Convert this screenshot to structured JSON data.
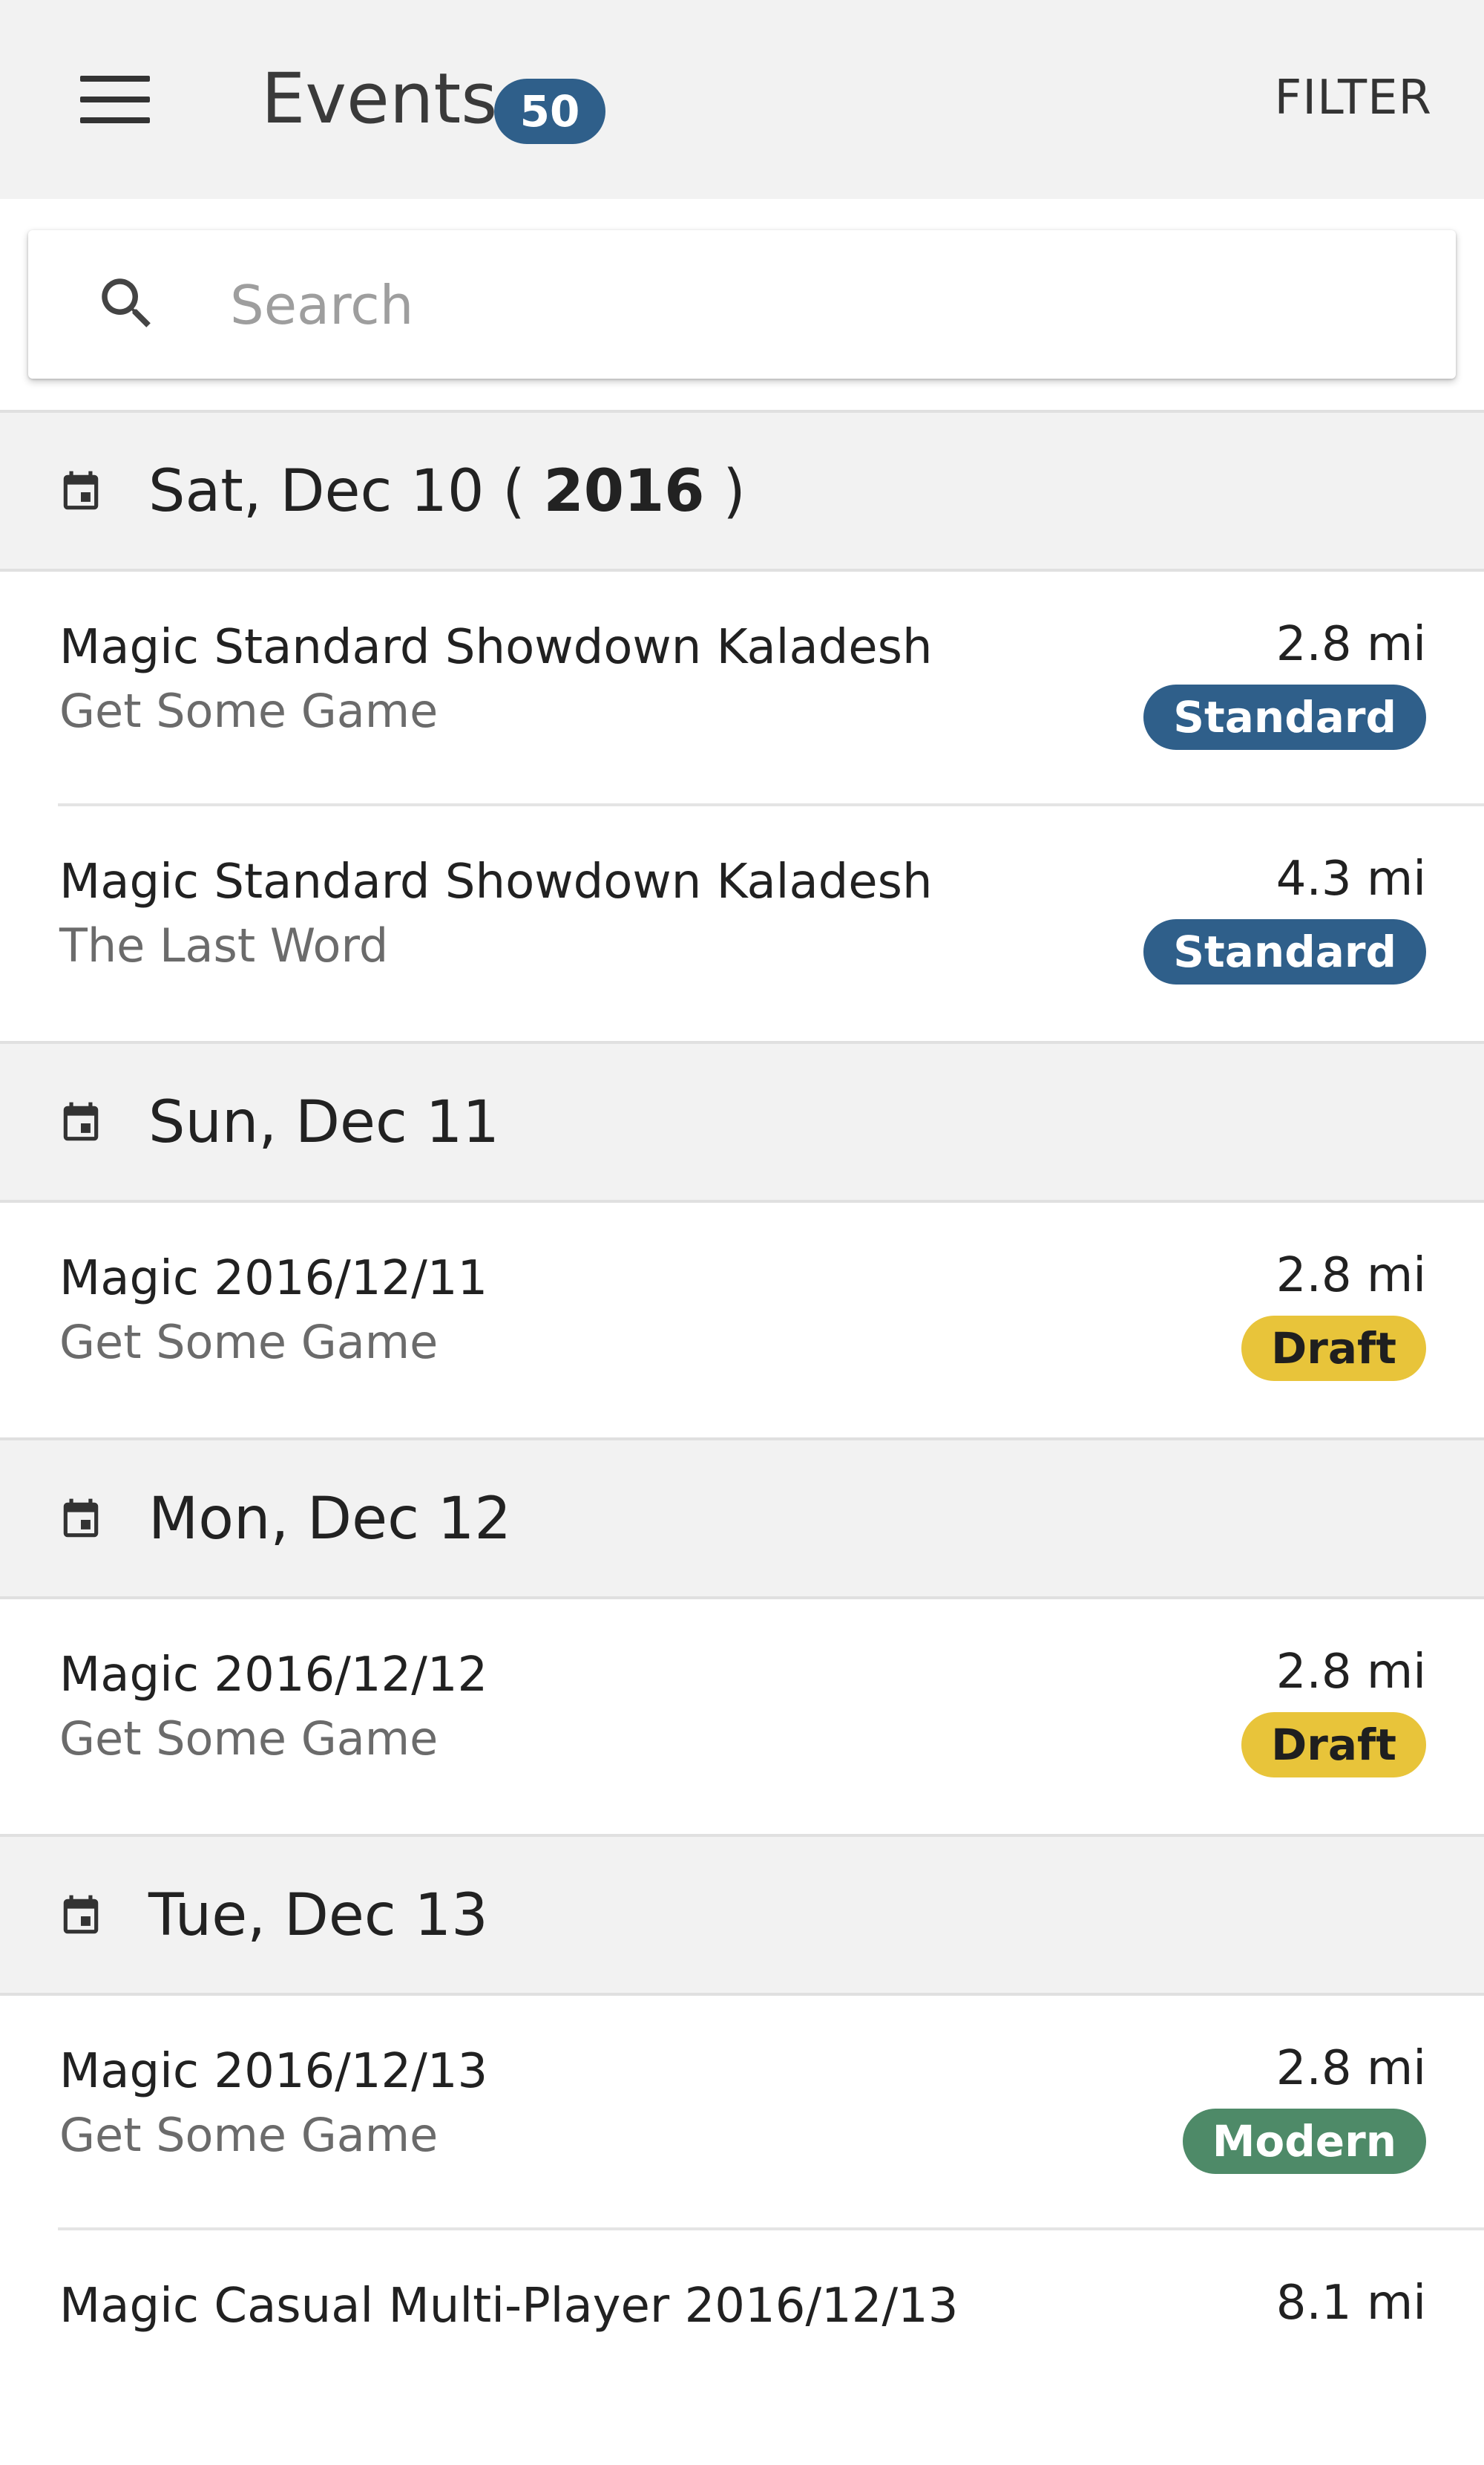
{
  "header": {
    "title": "Events",
    "count_badge": "50",
    "filter_label": "FILTER"
  },
  "search": {
    "placeholder": "Search",
    "value": ""
  },
  "icons": {
    "menu": "menu-icon",
    "search": "search-icon",
    "calendar": "calendar-icon"
  },
  "colors": {
    "Standard": "#2f5f8a",
    "Draft": "#e8c43a",
    "Modern": "#4e8a68"
  },
  "groups": [
    {
      "date": "Sat, Dec 10 (",
      "year": "2016",
      "date_suffix": ")",
      "events": [
        {
          "title": "Magic Standard Showdown Kaladesh",
          "store": "Get Some Game",
          "distance": "2.8 mi",
          "format": "Standard"
        },
        {
          "title": "Magic Standard Showdown Kaladesh",
          "store": "The Last Word",
          "distance": "4.3 mi",
          "format": "Standard"
        }
      ]
    },
    {
      "date": "Sun, Dec 11",
      "events": [
        {
          "title": "Magic 2016/12/11",
          "store": "Get Some Game",
          "distance": "2.8 mi",
          "format": "Draft"
        }
      ]
    },
    {
      "date": "Mon, Dec 12",
      "events": [
        {
          "title": "Magic 2016/12/12",
          "store": "Get Some Game",
          "distance": "2.8 mi",
          "format": "Draft"
        }
      ]
    },
    {
      "date": "Tue, Dec 13",
      "events": [
        {
          "title": "Magic 2016/12/13",
          "store": "Get Some Game",
          "distance": "2.8 mi",
          "format": "Modern"
        },
        {
          "title": "Magic Casual Multi-Player 2016/12/13",
          "store": "",
          "distance": "8.1 mi",
          "format": ""
        }
      ]
    }
  ]
}
